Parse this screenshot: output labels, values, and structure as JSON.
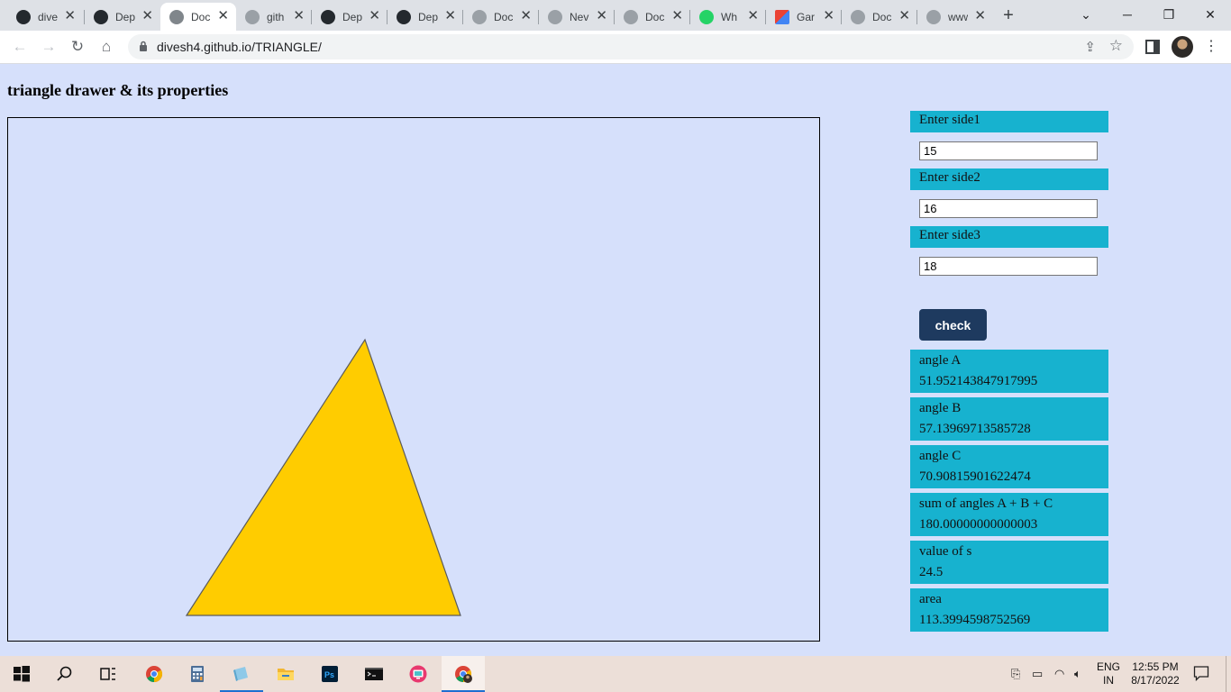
{
  "browser": {
    "tabs": [
      {
        "title": "dive",
        "icon": "github-icon",
        "active": false
      },
      {
        "title": "Dep",
        "icon": "github-icon",
        "active": false
      },
      {
        "title": "Doc",
        "icon": "globe-icon",
        "active": true
      },
      {
        "title": "gith",
        "icon": "globe-icon",
        "active": false
      },
      {
        "title": "Dep",
        "icon": "github-icon",
        "active": false
      },
      {
        "title": "Dep",
        "icon": "github-icon",
        "active": false
      },
      {
        "title": "Doc",
        "icon": "globe-icon",
        "active": false
      },
      {
        "title": "Nev",
        "icon": "globe-icon",
        "active": false
      },
      {
        "title": "Doc",
        "icon": "globe-icon",
        "active": false
      },
      {
        "title": "Wh",
        "icon": "whatsapp-icon",
        "active": false
      },
      {
        "title": "Gar",
        "icon": "gmail-icon",
        "active": false
      },
      {
        "title": "Doc",
        "icon": "globe-icon",
        "active": false
      },
      {
        "title": "www",
        "icon": "globe-icon",
        "active": false
      }
    ],
    "url": "divesh4.github.io/TRIANGLE/"
  },
  "page": {
    "heading": "triangle drawer & its properties",
    "triangle_fill": "#ffcc00",
    "inputs": [
      {
        "label": "Enter side1",
        "value": "15"
      },
      {
        "label": "Enter side2",
        "value": "16"
      },
      {
        "label": "Enter side3",
        "value": "18"
      }
    ],
    "check_label": "check",
    "results": [
      {
        "label": "angle A",
        "value": "51.952143847917995"
      },
      {
        "label": "angle B",
        "value": "57.13969713585728"
      },
      {
        "label": "angle C",
        "value": "70.90815901622474"
      },
      {
        "label": "sum of angles A + B + C",
        "value": "180.00000000000003"
      },
      {
        "label": "value of s",
        "value": "24.5"
      },
      {
        "label": "area",
        "value": "113.3994598752569"
      }
    ]
  },
  "taskbar": {
    "apps": [
      "start-icon",
      "search-icon",
      "task-view-icon",
      "chrome-icon",
      "calculator-icon",
      "notepad-icon",
      "file-explorer-icon",
      "photoshop-icon",
      "terminal-icon",
      "screen-recorder-icon",
      "chrome-profile-icon"
    ],
    "language": "ENG",
    "region": "IN",
    "time": "12:55 PM",
    "date": "8/17/2022"
  },
  "colors": {
    "page_bg": "#d6e0fb",
    "panel_bg": "#17b2cf",
    "button_bg": "#1e3a5f"
  }
}
